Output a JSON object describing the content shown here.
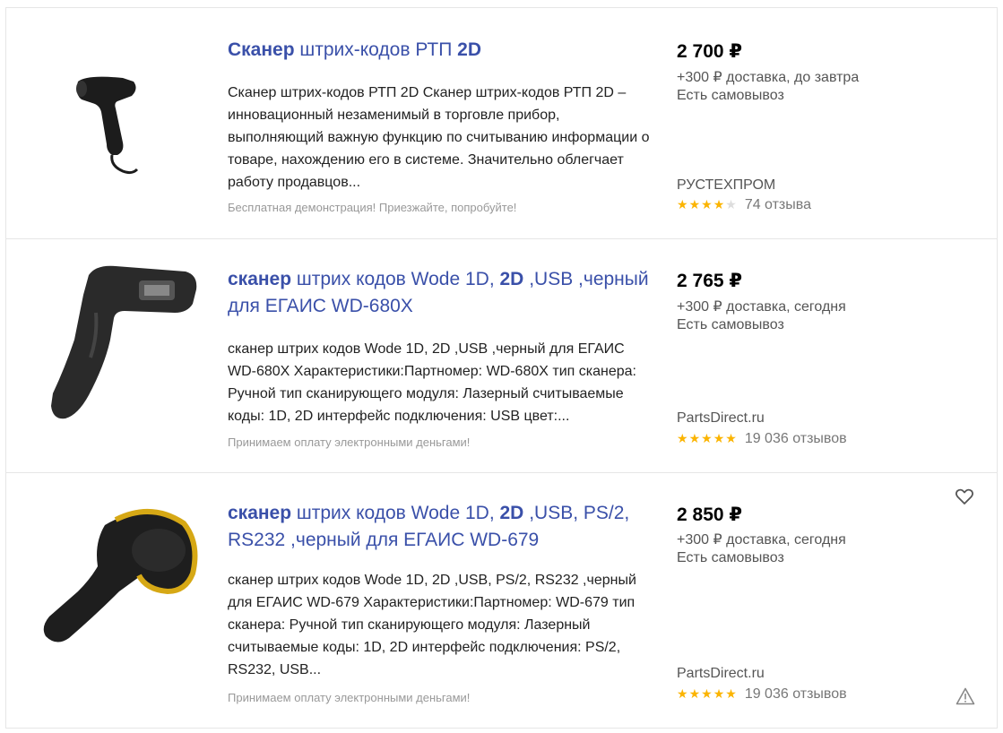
{
  "colors": {
    "link": "#3a50a9",
    "star": "#fbb400",
    "star_empty": "#dddddd",
    "muted": "#999999"
  },
  "items": [
    {
      "title_bold1": "Сканер",
      "title_mid": " штрих-кодов РТП ",
      "title_bold2": "2D",
      "title_end": "",
      "description": "Сканер штрих-кодов РТП 2D Сканер штрих-кодов РТП 2D – инновационный незаменимый в торговле прибор, выполняющий важную функцию по считыванию информации о товаре, нахождению его в системе. Значительно облегчает работу продавцов...",
      "promo": "Бесплатная демонстрация! Приезжайте, попробуйте!",
      "price": "2 700 ₽",
      "delivery": "+300 ₽ доставка, до завтра",
      "pickup": "Есть самовывоз",
      "shop": "РУСТЕХПРОМ",
      "rating": 4,
      "reviews": "74 отзыва"
    },
    {
      "title_bold1": "сканер",
      "title_mid": " штрих кодов Wode 1D, ",
      "title_bold2": "2D",
      "title_end": " ,USB ,черный для ЕГАИС WD-680X",
      "description": "сканер штрих кодов Wode 1D, 2D ,USB ,черный для ЕГАИС WD-680X Характеристики:Партномер: WD-680X тип сканера: Ручной тип сканирующего модуля: Лазерный считываемые коды: 1D, 2D интерфейс подключения: USB цвет:...",
      "promo": "Принимаем оплату электронными деньгами!",
      "price": "2 765 ₽",
      "delivery": "+300 ₽ доставка, сегодня",
      "pickup": "Есть самовывоз",
      "shop": "PartsDirect.ru",
      "rating": 5,
      "reviews": "19 036 отзывов"
    },
    {
      "title_bold1": "сканер",
      "title_mid": " штрих кодов Wode 1D, ",
      "title_bold2": "2D",
      "title_end": " ,USB, PS/2, RS232 ,черный для ЕГАИС WD-679",
      "description": "сканер штрих кодов Wode 1D, 2D ,USB, PS/2, RS232 ,черный для ЕГАИС WD-679 Характеристики:Партномер: WD-679 тип сканера: Ручной тип сканирующего модуля: Лазерный считываемые коды: 1D, 2D интерфейс подключения: PS/2, RS232, USB...",
      "promo": "Принимаем оплату электронными деньгами!",
      "price": "2 850 ₽",
      "delivery": "+300 ₽ доставка, сегодня",
      "pickup": "Есть самовывоз",
      "shop": "PartsDirect.ru",
      "rating": 5,
      "reviews": "19 036 отзывов"
    }
  ],
  "icons": {
    "favorite": "heart-icon",
    "complaint": "warning-icon"
  }
}
